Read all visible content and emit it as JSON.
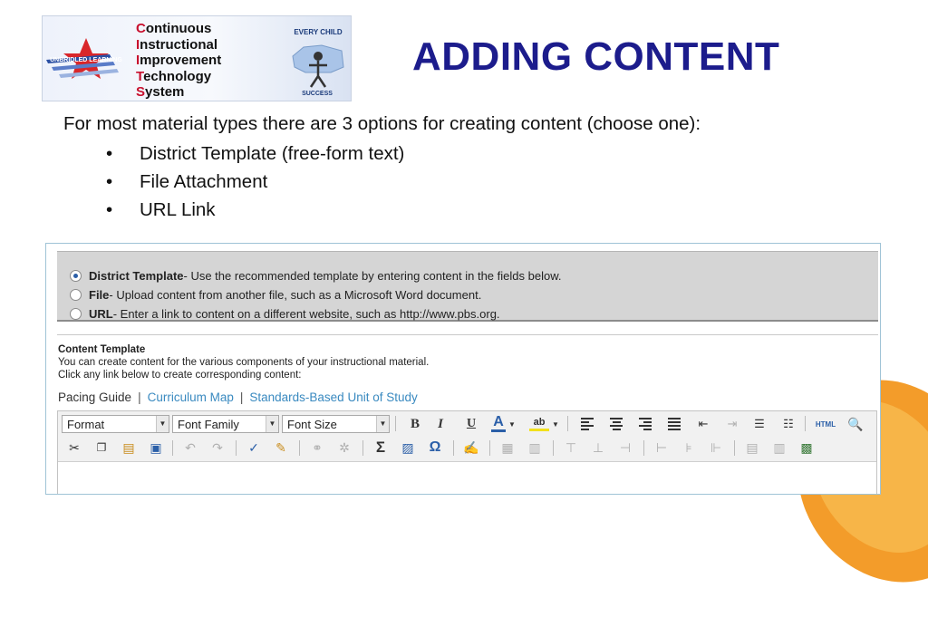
{
  "logo": {
    "lines": [
      {
        "cap": "C",
        "rest": "ontinuous"
      },
      {
        "cap": "I",
        "rest": "nstructional"
      },
      {
        "cap": "I",
        "rest": "mprovement"
      },
      {
        "cap": "T",
        "rest": "echnology"
      },
      {
        "cap": "S",
        "rest": "ystem"
      }
    ],
    "mark_text": "UNBRIDLED LEARNING",
    "badge_top": "EVERY CHILD",
    "badge_bottom": "SUCCESS"
  },
  "title": "ADDING CONTENT",
  "intro": "For most material types there are 3 options for creating content (choose one):",
  "bullets": [
    "District Template (free-form text)",
    "File Attachment",
    "URL Link"
  ],
  "options": [
    {
      "label": "District Template",
      "desc": " - Use the recommended template by entering content in the fields below.",
      "selected": true
    },
    {
      "label": "File",
      "desc": " - Upload content from another file, such as a Microsoft Word document.",
      "selected": false
    },
    {
      "label": "URL",
      "desc": " - Enter a link to content on a different website, such as http://www.pbs.org.",
      "selected": false
    }
  ],
  "content_template": {
    "title": "Content Template",
    "line1": "You can create content for the various components of your instructional material.",
    "line2": "Click any link below to create corresponding content:"
  },
  "tabs": {
    "current": "Pacing Guide",
    "separator": "|",
    "links": [
      "Curriculum Map",
      "Standards-Based Unit of Study"
    ]
  },
  "toolbar": {
    "format": "Format",
    "font_family": "Font Family",
    "font_size": "Font Size",
    "dropdown_arrow": "▼",
    "bold": "B",
    "italic": "I",
    "underline": "U",
    "font_color": "A",
    "highlight": "ab",
    "html": "HTML",
    "sigma": "Σ",
    "omega": "Ω"
  },
  "colors": {
    "title": "#1c1c8c",
    "link": "#3a8ac0",
    "accent_orange": "#f39c2a",
    "logo_red": "#c8102e"
  }
}
